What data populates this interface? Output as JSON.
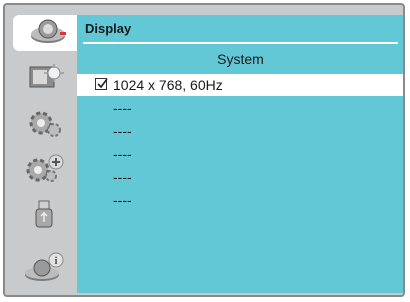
{
  "menu": {
    "title": "Display",
    "section_header": "System",
    "selected_item": "1024 x 768, 60Hz",
    "items": [
      "----",
      "----",
      "----",
      "----",
      "----"
    ]
  },
  "sidebar": {
    "icons": [
      "camera-icon",
      "image-adjust-icon",
      "gear-icon",
      "gear-plus-icon",
      "usb-icon",
      "info-icon"
    ],
    "active_index": 0
  }
}
